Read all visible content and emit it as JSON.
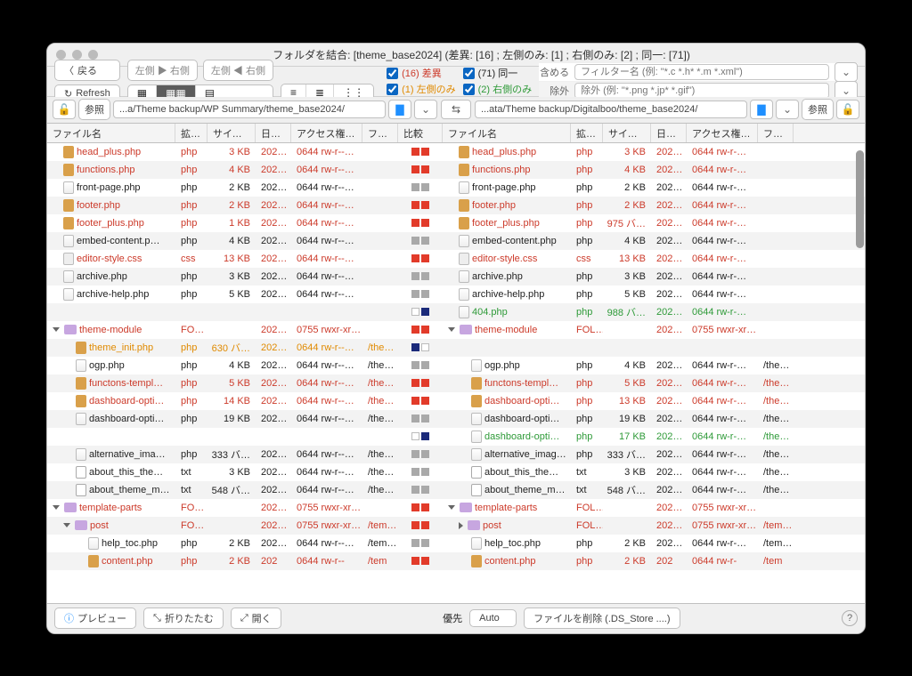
{
  "window": {
    "title": "フォルダを結合: [theme_base2024] (差異: [16] ; 左側のみ: [1] ; 右側のみ: [2] ; 同一: [71])"
  },
  "toolbar": {
    "back_label": "戻る",
    "btn_lr": "左側 ▶ 右側",
    "btn_rl": "左側 ◀ 右側",
    "refresh_label": "Refresh"
  },
  "checks": {
    "diff": "(16) 差異",
    "left_only": "(1) 左側のみ",
    "same": "(71) 同一",
    "right_only": "(2) 右側のみ"
  },
  "filter": {
    "include_label": "含める",
    "exclude_label": "除外",
    "include_placeholder": "フィルター名 (例: \"*.c *.h* *.m *.xml\")",
    "exclude_placeholder": "除外 (例: \"*.png *.jp* *.gif\")"
  },
  "pathbar": {
    "left_browse": "参照",
    "right_browse": "参照",
    "left_path": "...a/Theme backup/WP Summary/theme_base2024/",
    "right_path": "...ata/Theme backup/Digitalboo/theme_base2024/"
  },
  "headers": {
    "filename": "ファイル名",
    "ext": "拡張子",
    "size_left": "サイズ(左側)",
    "size_right": "サイズ(右側)",
    "date": "日付(…",
    "perm_left": "アクセス権(左側)",
    "perm_right": "アクセス権(右側)",
    "folder": "フォ…",
    "compare": "比較"
  },
  "footer": {
    "preview": "プレビュー",
    "collapse": "折りたたむ",
    "open": "開く",
    "priority_label": "優先",
    "priority_value": "Auto",
    "delete_label": "ファイルを削除 (.DS_Store ....)"
  },
  "rows": [
    {
      "l": {
        "n": "head_plus.php",
        "e": "php",
        "s": "3 KB",
        "d": "202…",
        "p": "0644 rw-r--…",
        "cls": "red",
        "in": 1,
        "ic": "php"
      },
      "c": [
        "r",
        "r"
      ],
      "r": {
        "n": "head_plus.php",
        "e": "php",
        "s": "3 KB",
        "d": "202…",
        "p": "0644 rw-r-…",
        "cls": "red",
        "in": 1,
        "ic": "php"
      }
    },
    {
      "l": {
        "n": "functions.php",
        "e": "php",
        "s": "4 KB",
        "d": "202…",
        "p": "0644 rw-r--…",
        "cls": "red",
        "in": 1,
        "ic": "php"
      },
      "c": [
        "r",
        "r"
      ],
      "r": {
        "n": "functions.php",
        "e": "php",
        "s": "4 KB",
        "d": "202…",
        "p": "0644 rw-r-…",
        "cls": "red",
        "in": 1,
        "ic": "php"
      }
    },
    {
      "l": {
        "n": "front-page.php",
        "e": "php",
        "s": "2 KB",
        "d": "202…",
        "p": "0644 rw-r--…",
        "cls": "",
        "in": 1,
        "ic": "doc"
      },
      "c": [
        "g",
        "g"
      ],
      "r": {
        "n": "front-page.php",
        "e": "php",
        "s": "2 KB",
        "d": "202…",
        "p": "0644 rw-r-…",
        "cls": "",
        "in": 1,
        "ic": "doc"
      }
    },
    {
      "l": {
        "n": "footer.php",
        "e": "php",
        "s": "2 KB",
        "d": "202…",
        "p": "0644 rw-r--…",
        "cls": "red",
        "in": 1,
        "ic": "php"
      },
      "c": [
        "r",
        "r"
      ],
      "r": {
        "n": "footer.php",
        "e": "php",
        "s": "2 KB",
        "d": "202…",
        "p": "0644 rw-r-…",
        "cls": "red",
        "in": 1,
        "ic": "php"
      }
    },
    {
      "l": {
        "n": "footer_plus.php",
        "e": "php",
        "s": "1 KB",
        "d": "202…",
        "p": "0644 rw-r--…",
        "cls": "red",
        "in": 1,
        "ic": "php"
      },
      "c": [
        "r",
        "r"
      ],
      "r": {
        "n": "footer_plus.php",
        "e": "php",
        "s": "975 バ…",
        "d": "202…",
        "p": "0644 rw-r-…",
        "cls": "red",
        "in": 1,
        "ic": "php"
      }
    },
    {
      "l": {
        "n": "embed-content.p…",
        "e": "php",
        "s": "4 KB",
        "d": "202…",
        "p": "0644 rw-r--…",
        "cls": "",
        "in": 1,
        "ic": "doc"
      },
      "c": [
        "g",
        "g"
      ],
      "r": {
        "n": "embed-content.php",
        "e": "php",
        "s": "4 KB",
        "d": "202…",
        "p": "0644 rw-r-…",
        "cls": "",
        "in": 1,
        "ic": "doc"
      }
    },
    {
      "l": {
        "n": "editor-style.css",
        "e": "css",
        "s": "13 KB",
        "d": "202…",
        "p": "0644 rw-r--…",
        "cls": "red",
        "in": 1,
        "ic": "css"
      },
      "c": [
        "r",
        "r"
      ],
      "r": {
        "n": "editor-style.css",
        "e": "css",
        "s": "13 KB",
        "d": "202…",
        "p": "0644 rw-r-…",
        "cls": "red",
        "in": 1,
        "ic": "css"
      }
    },
    {
      "l": {
        "n": "archive.php",
        "e": "php",
        "s": "3 KB",
        "d": "202…",
        "p": "0644 rw-r--…",
        "cls": "",
        "in": 1,
        "ic": "doc"
      },
      "c": [
        "g",
        "g"
      ],
      "r": {
        "n": "archive.php",
        "e": "php",
        "s": "3 KB",
        "d": "202…",
        "p": "0644 rw-r-…",
        "cls": "",
        "in": 1,
        "ic": "doc"
      }
    },
    {
      "l": {
        "n": "archive-help.php",
        "e": "php",
        "s": "5 KB",
        "d": "202…",
        "p": "0644 rw-r--…",
        "cls": "",
        "in": 1,
        "ic": "doc"
      },
      "c": [
        "g",
        "g"
      ],
      "r": {
        "n": "archive-help.php",
        "e": "php",
        "s": "5 KB",
        "d": "202…",
        "p": "0644 rw-r-…",
        "cls": "",
        "in": 1,
        "ic": "doc"
      }
    },
    {
      "l": {
        "empty": true
      },
      "c": [
        "w",
        "b"
      ],
      "r": {
        "n": "404.php",
        "e": "php",
        "s": "988 バ…",
        "d": "202…",
        "p": "0644 rw-r-…",
        "cls": "green",
        "in": 1,
        "ic": "doc"
      }
    },
    {
      "l": {
        "n": "theme-module",
        "e": "FO…",
        "s": "",
        "d": "202…",
        "p": "0755 rwxr-xr…",
        "cls": "red",
        "in": 0,
        "ic": "folder",
        "tri": "down"
      },
      "c": [
        "r",
        "r"
      ],
      "r": {
        "n": "theme-module",
        "e": "FOL…",
        "s": "",
        "d": "202…",
        "p": "0755 rwxr-xr…",
        "cls": "red",
        "in": 0,
        "ic": "folder",
        "tri": "down"
      }
    },
    {
      "l": {
        "n": "theme_init.php",
        "e": "php",
        "s": "630 バ…",
        "d": "202…",
        "p": "0644 rw-r--…",
        "f": "/the…",
        "cls": "orange",
        "in": 2,
        "ic": "php"
      },
      "c": [
        "b",
        "w"
      ],
      "r": {
        "empty": true
      }
    },
    {
      "l": {
        "n": "ogp.php",
        "e": "php",
        "s": "4 KB",
        "d": "202…",
        "p": "0644 rw-r--…",
        "f": "/the…",
        "cls": "",
        "in": 2,
        "ic": "doc"
      },
      "c": [
        "g",
        "g"
      ],
      "r": {
        "n": "ogp.php",
        "e": "php",
        "s": "4 KB",
        "d": "202…",
        "p": "0644 rw-r-…",
        "f": "/the…",
        "cls": "",
        "in": 2,
        "ic": "doc"
      }
    },
    {
      "l": {
        "n": "functons-templ…",
        "e": "php",
        "s": "5 KB",
        "d": "202…",
        "p": "0644 rw-r--…",
        "f": "/the…",
        "cls": "red",
        "in": 2,
        "ic": "php"
      },
      "c": [
        "r",
        "r"
      ],
      "r": {
        "n": "functons-templ…",
        "e": "php",
        "s": "5 KB",
        "d": "202…",
        "p": "0644 rw-r-…",
        "f": "/the…",
        "cls": "red",
        "in": 2,
        "ic": "php"
      }
    },
    {
      "l": {
        "n": "dashboard-opti…",
        "e": "php",
        "s": "14 KB",
        "d": "202…",
        "p": "0644 rw-r--…",
        "f": "/the…",
        "cls": "red",
        "in": 2,
        "ic": "php"
      },
      "c": [
        "r",
        "r"
      ],
      "r": {
        "n": "dashboard-opti…",
        "e": "php",
        "s": "13 KB",
        "d": "202…",
        "p": "0644 rw-r-…",
        "f": "/the…",
        "cls": "red",
        "in": 2,
        "ic": "php"
      }
    },
    {
      "l": {
        "n": "dashboard-opti…",
        "e": "php",
        "s": "19 KB",
        "d": "202…",
        "p": "0644 rw-r--…",
        "f": "/the…",
        "cls": "",
        "in": 2,
        "ic": "doc"
      },
      "c": [
        "g",
        "g"
      ],
      "r": {
        "n": "dashboard-opti…",
        "e": "php",
        "s": "19 KB",
        "d": "202…",
        "p": "0644 rw-r-…",
        "f": "/the…",
        "cls": "",
        "in": 2,
        "ic": "doc"
      }
    },
    {
      "l": {
        "empty": true
      },
      "c": [
        "w",
        "b"
      ],
      "r": {
        "n": "dashboard-opti…",
        "e": "php",
        "s": "17 KB",
        "d": "202…",
        "p": "0644 rw-r-…",
        "f": "/the…",
        "cls": "green",
        "in": 2,
        "ic": "doc"
      }
    },
    {
      "l": {
        "n": "alternative_ima…",
        "e": "php",
        "s": "333 バ…",
        "d": "202…",
        "p": "0644 rw-r--…",
        "f": "/the…",
        "cls": "",
        "in": 2,
        "ic": "doc"
      },
      "c": [
        "g",
        "g"
      ],
      "r": {
        "n": "alternative_imag…",
        "e": "php",
        "s": "333 バ…",
        "d": "202…",
        "p": "0644 rw-r-…",
        "f": "/the…",
        "cls": "",
        "in": 2,
        "ic": "doc"
      }
    },
    {
      "l": {
        "n": "about_this_the…",
        "e": "txt",
        "s": "3 KB",
        "d": "202…",
        "p": "0644 rw-r--…",
        "f": "/the…",
        "cls": "",
        "in": 2,
        "ic": "txt"
      },
      "c": [
        "g",
        "g"
      ],
      "r": {
        "n": "about_this_the…",
        "e": "txt",
        "s": "3 KB",
        "d": "202…",
        "p": "0644 rw-r-…",
        "f": "/the…",
        "cls": "",
        "in": 2,
        "ic": "txt"
      }
    },
    {
      "l": {
        "n": "about_theme_m…",
        "e": "txt",
        "s": "548 バ…",
        "d": "202…",
        "p": "0644 rw-r--…",
        "f": "/the…",
        "cls": "",
        "in": 2,
        "ic": "txt"
      },
      "c": [
        "g",
        "g"
      ],
      "r": {
        "n": "about_theme_m…",
        "e": "txt",
        "s": "548 バ…",
        "d": "202…",
        "p": "0644 rw-r-…",
        "f": "/the…",
        "cls": "",
        "in": 2,
        "ic": "txt"
      }
    },
    {
      "l": {
        "n": "template-parts",
        "e": "FO…",
        "s": "",
        "d": "202…",
        "p": "0755 rwxr-xr…",
        "cls": "red",
        "in": 0,
        "ic": "folder",
        "tri": "down"
      },
      "c": [
        "r",
        "r"
      ],
      "r": {
        "n": "template-parts",
        "e": "FOL…",
        "s": "",
        "d": "202…",
        "p": "0755 rwxr-xr…",
        "cls": "red",
        "in": 0,
        "ic": "folder",
        "tri": "down"
      }
    },
    {
      "l": {
        "n": "post",
        "e": "FO…",
        "s": "",
        "d": "202…",
        "p": "0755 rwxr-xr…",
        "f": "/tem…",
        "cls": "red",
        "in": 1,
        "ic": "folder",
        "tri": "down"
      },
      "c": [
        "r",
        "r"
      ],
      "r": {
        "n": "post",
        "e": "FOL…",
        "s": "",
        "d": "202…",
        "p": "0755 rwxr-xr…",
        "f": "/tem…",
        "cls": "red",
        "in": 1,
        "ic": "folder",
        "tri": "right"
      }
    },
    {
      "l": {
        "n": "help_toc.php",
        "e": "php",
        "s": "2 KB",
        "d": "202…",
        "p": "0644 rw-r--…",
        "f": "/tem…",
        "cls": "",
        "in": 3,
        "ic": "doc"
      },
      "c": [
        "g",
        "g"
      ],
      "r": {
        "n": "help_toc.php",
        "e": "php",
        "s": "2 KB",
        "d": "202…",
        "p": "0644 rw-r-…",
        "f": "/tem…",
        "cls": "",
        "in": 2,
        "ic": "doc"
      }
    },
    {
      "l": {
        "n": "content.php",
        "e": "php",
        "s": "2 KB",
        "d": "202",
        "p": "0644 rw-r--",
        "f": "/tem",
        "cls": "red",
        "in": 3,
        "ic": "php"
      },
      "c": [
        "r",
        "r"
      ],
      "r": {
        "n": "content.php",
        "e": "php",
        "s": "2 KB",
        "d": "202",
        "p": "0644 rw-r-",
        "f": "/tem",
        "cls": "red",
        "in": 2,
        "ic": "php"
      }
    }
  ]
}
